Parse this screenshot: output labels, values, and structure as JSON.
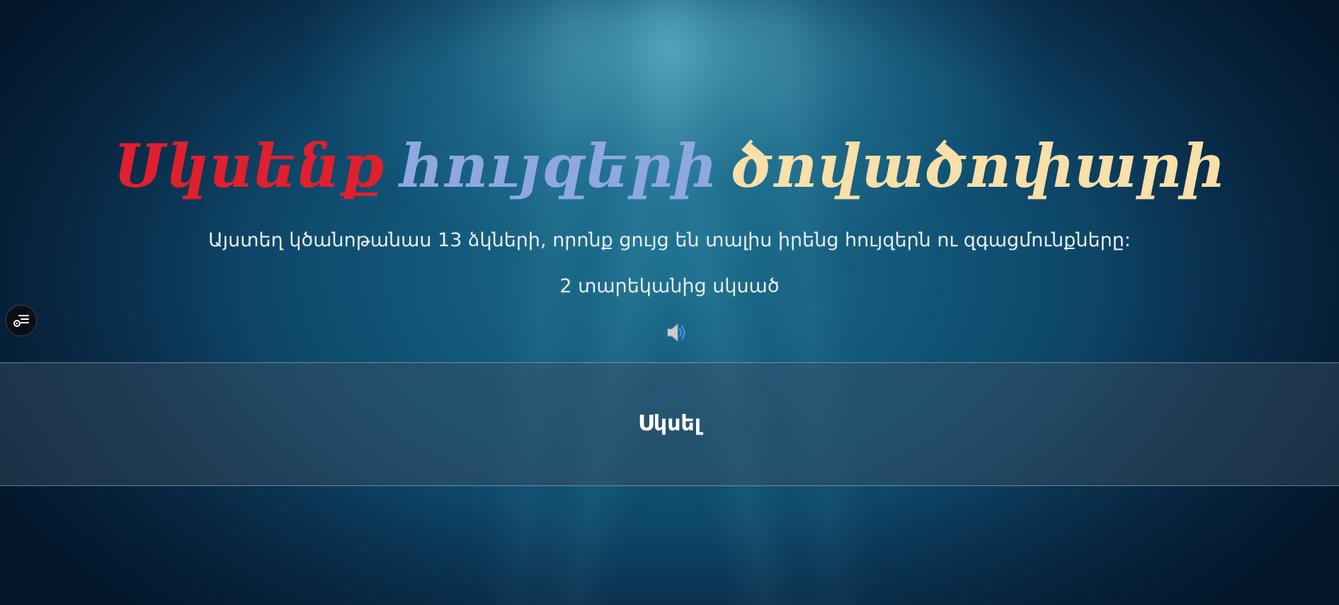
{
  "title": {
    "word1": "Սկսենք",
    "word2": "հույզերի",
    "word3": "ծովածոփարի"
  },
  "subtitle": "Այստեղ կծանոթանաս 13 ձկների, որոնք ցույց են տալիս իրենց հույզերն ու զգացմունքները:",
  "age_note": "2 տարեկանից սկսած",
  "start_button_label": "Սկսել",
  "icons": {
    "sound": "speaker-icon",
    "menu": "menu-list-icon"
  },
  "colors": {
    "title_word1": "#e0202e",
    "title_word2": "#8fa8e0",
    "title_word3": "#f9dfa8"
  }
}
